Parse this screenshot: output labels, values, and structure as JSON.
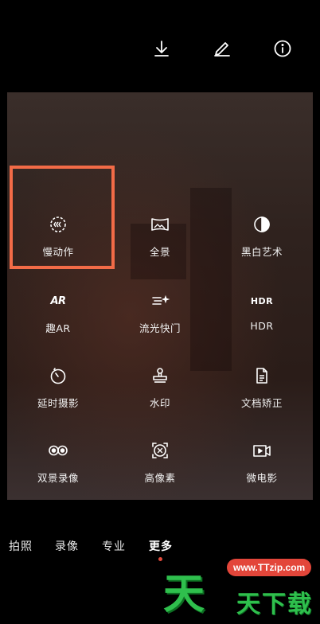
{
  "toolbar": {
    "download_icon": "download-icon",
    "edit_icon": "pencil-icon",
    "info_icon": "info-icon"
  },
  "modes_grid": [
    {
      "label": "慢动作",
      "icon": "slow-motion-icon"
    },
    {
      "label": "全景",
      "icon": "panorama-icon"
    },
    {
      "label": "黑白艺术",
      "icon": "monochrome-icon"
    },
    {
      "label": "趣AR",
      "icon": "ar-icon",
      "icon_text": "AR"
    },
    {
      "label": "流光快门",
      "icon": "light-trail-icon"
    },
    {
      "label": "HDR",
      "icon": "hdr-icon",
      "icon_text": "HDR"
    },
    {
      "label": "延时摄影",
      "icon": "timelapse-icon"
    },
    {
      "label": "水印",
      "icon": "watermark-stamp-icon"
    },
    {
      "label": "文档矫正",
      "icon": "document-icon"
    },
    {
      "label": "双景录像",
      "icon": "dual-view-icon"
    },
    {
      "label": "高像素",
      "icon": "high-res-icon"
    },
    {
      "label": "微电影",
      "icon": "micro-movie-icon"
    }
  ],
  "bottom_modes": [
    {
      "label": "拍照",
      "active": false
    },
    {
      "label": "录像",
      "active": false
    },
    {
      "label": "专业",
      "active": false
    },
    {
      "label": "更多",
      "active": true
    }
  ],
  "watermark": {
    "url": "www.TTzip.com",
    "big": "天",
    "small": "天下载"
  },
  "colors": {
    "highlight": "#f26b47",
    "active_dot": "#e34b3c",
    "watermark_green": "#2fbf4d",
    "watermark_red": "#e3463a"
  }
}
